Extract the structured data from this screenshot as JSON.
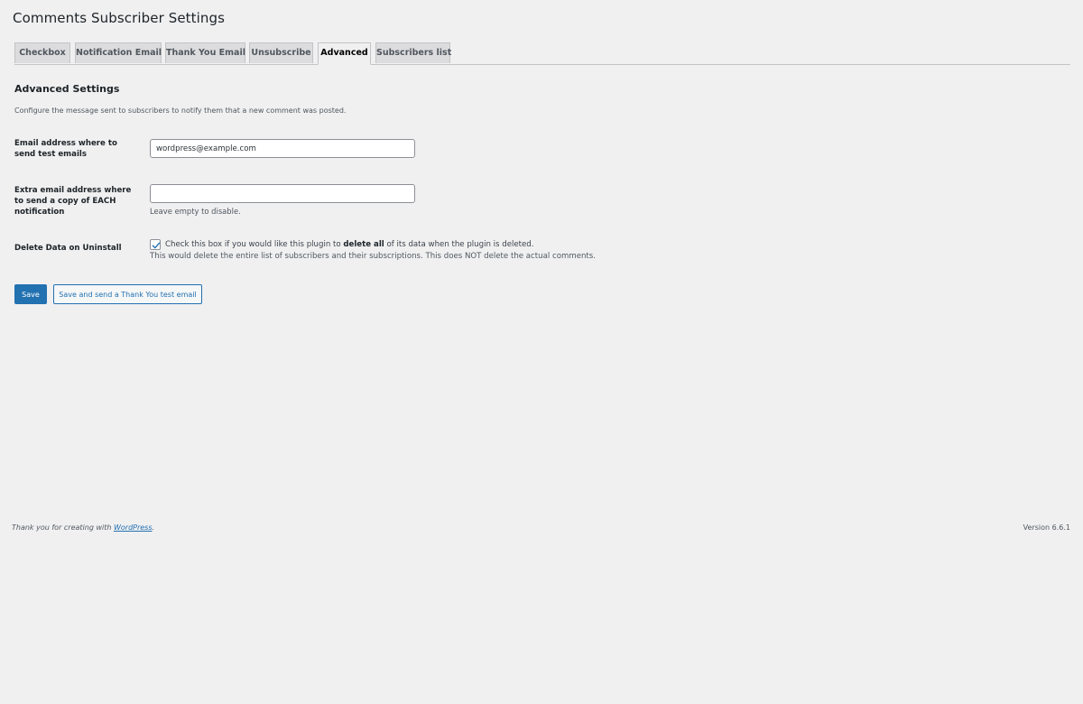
{
  "page_title": "Comments Subscriber Settings",
  "tabs": [
    {
      "label": "Checkbox"
    },
    {
      "label": "Notification Email"
    },
    {
      "label": "Thank You Email"
    },
    {
      "label": "Unsubscribe"
    },
    {
      "label": "Advanced",
      "active": true
    },
    {
      "label": "Subscribers list"
    }
  ],
  "section": {
    "title": "Advanced Settings",
    "description": "Configure the message sent to subscribers to notify them that a new comment was posted."
  },
  "fields": {
    "test_email": {
      "label": "Email address where to send test emails",
      "value": "wordpress@example.com"
    },
    "extra_email": {
      "label": "Extra email address where to send a copy of EACH notification",
      "value": "",
      "help": "Leave empty to disable."
    },
    "delete_data": {
      "label": "Delete Data on Uninstall",
      "checked": true,
      "check_text_before": "Check this box if you would like this plugin to ",
      "check_text_bold": "delete all",
      "check_text_after": " of its data when the plugin is deleted.",
      "description": "This would delete the entire list of subscribers and their subscriptions. This does NOT delete the actual comments."
    }
  },
  "buttons": {
    "save": "Save",
    "save_test": "Save and send a Thank You test email"
  },
  "footer": {
    "thanks_prefix": "Thank you for creating with ",
    "thanks_link": "WordPress",
    "thanks_suffix": ".",
    "version": "Version 6.6.1"
  },
  "colors": {
    "primary": "#2271b1",
    "background": "#f0f0f1"
  }
}
